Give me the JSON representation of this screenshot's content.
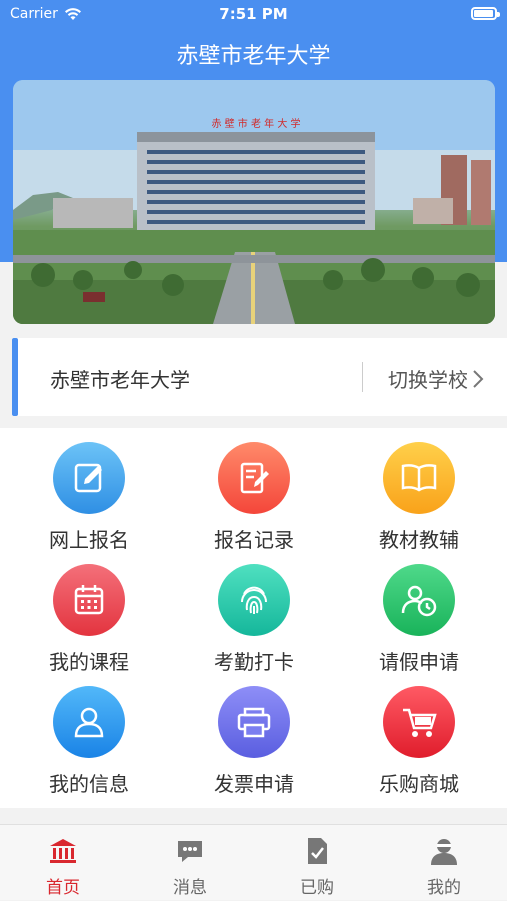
{
  "status_bar": {
    "carrier": "Carrier",
    "time": "7:51 PM"
  },
  "header": {
    "title": "赤壁市老年大学",
    "accent": "#4a8ff0"
  },
  "banner": {
    "sign_text": "赤 壁 市 老 年 大 学"
  },
  "school": {
    "name": "赤壁市老年大学",
    "switch_label": "切换学校"
  },
  "menu": [
    {
      "label": "网上报名",
      "icon": "edit-icon",
      "color_top": "#6cc3f7",
      "color_bottom": "#2f8fe4"
    },
    {
      "label": "报名记录",
      "icon": "document-edit-icon",
      "color_top": "#ff8a6a",
      "color_bottom": "#f4463a"
    },
    {
      "label": "教材教辅",
      "icon": "book-icon",
      "color_top": "#ffd04a",
      "color_bottom": "#f9a21a"
    },
    {
      "label": "我的课程",
      "icon": "calendar-icon",
      "color_top": "#f4707a",
      "color_bottom": "#e3343f"
    },
    {
      "label": "考勤打卡",
      "icon": "fingerprint-icon",
      "color_top": "#4fe0c0",
      "color_bottom": "#15b79b"
    },
    {
      "label": "请假申请",
      "icon": "user-clock-icon",
      "color_top": "#4fd98a",
      "color_bottom": "#19b35a"
    },
    {
      "label": "我的信息",
      "icon": "user-icon",
      "color_top": "#52b8f9",
      "color_bottom": "#1a83e6"
    },
    {
      "label": "发票申请",
      "icon": "printer-icon",
      "color_top": "#8e8ef7",
      "color_bottom": "#5a5ee0"
    },
    {
      "label": "乐购商城",
      "icon": "cart-icon",
      "color_top": "#ff5a64",
      "color_bottom": "#e01d2c"
    }
  ],
  "tabs": [
    {
      "label": "首页",
      "icon": "bank-icon",
      "active": true
    },
    {
      "label": "消息",
      "icon": "chat-icon",
      "active": false
    },
    {
      "label": "已购",
      "icon": "purchased-icon",
      "active": false
    },
    {
      "label": "我的",
      "icon": "profile-icon",
      "active": false
    }
  ]
}
